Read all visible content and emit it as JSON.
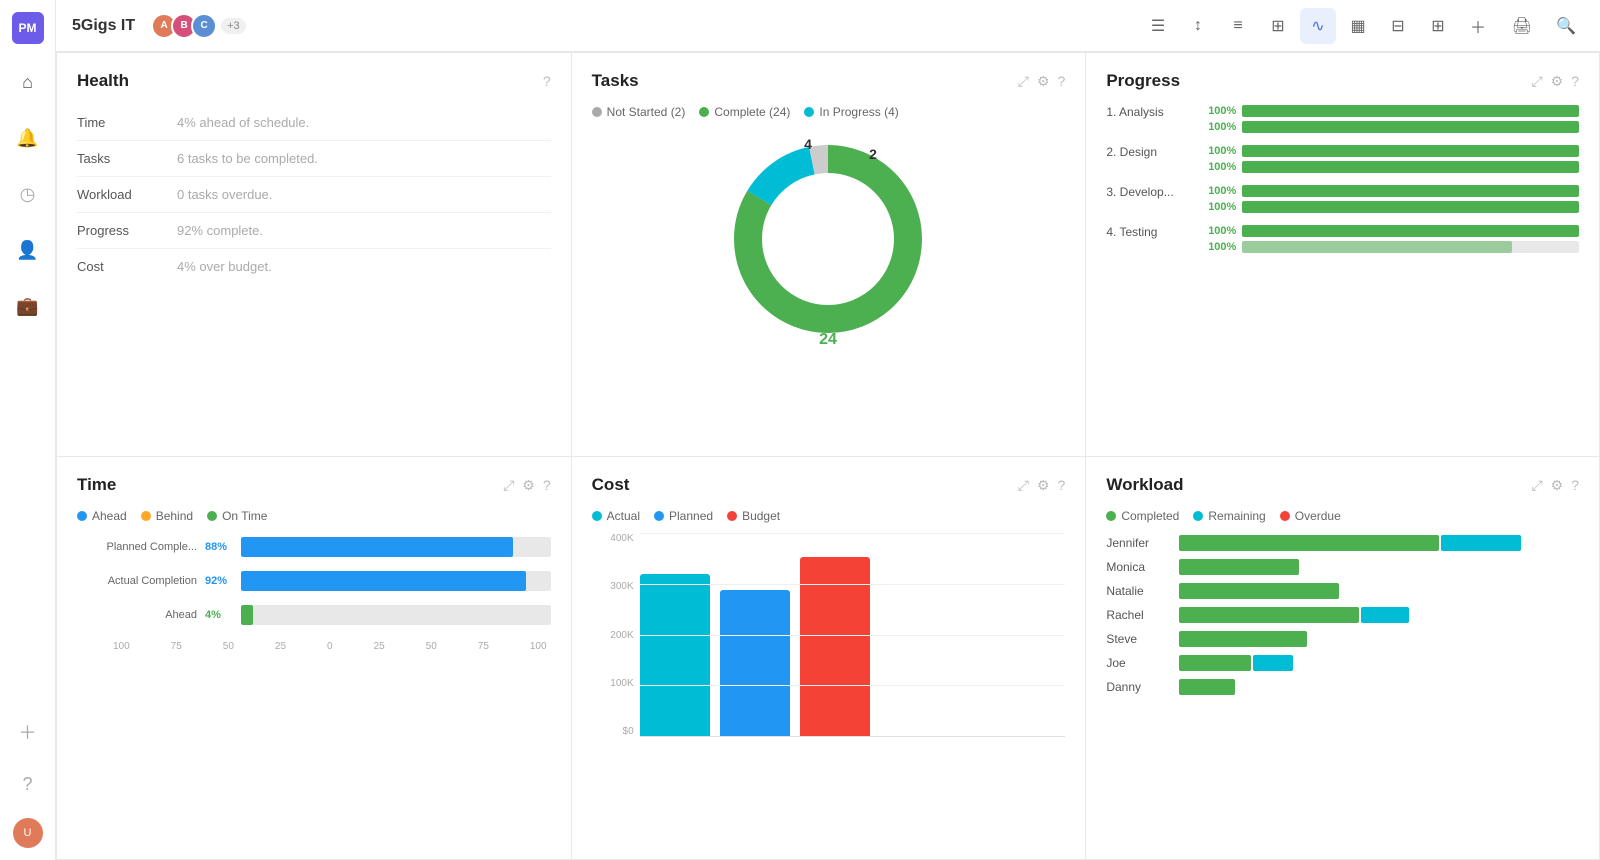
{
  "app": {
    "logo_text": "PM",
    "project_title": "5Gigs IT",
    "member_count": "+3"
  },
  "nav": {
    "icons": [
      "☰",
      "↕",
      "≡",
      "⊞",
      "∿",
      "▦",
      "⊟",
      "+"
    ],
    "right_icons": [
      "🖨",
      "🔍"
    ]
  },
  "health": {
    "title": "Health",
    "rows": [
      {
        "label": "Time",
        "value": "4% ahead of schedule."
      },
      {
        "label": "Tasks",
        "value": "6 tasks to be completed."
      },
      {
        "label": "Workload",
        "value": "0 tasks overdue."
      },
      {
        "label": "Progress",
        "value": "92% complete."
      },
      {
        "label": "Cost",
        "value": "4% over budget."
      }
    ]
  },
  "tasks": {
    "title": "Tasks",
    "legend": [
      {
        "label": "Not Started (2)",
        "color": "#aaa"
      },
      {
        "label": "Complete (24)",
        "color": "#4caf50"
      },
      {
        "label": "In Progress (4)",
        "color": "#00bcd4"
      }
    ],
    "not_started": 2,
    "complete": 24,
    "in_progress": 4,
    "labels": {
      "top_left": "4",
      "top_right": "2",
      "bottom": "24"
    }
  },
  "progress": {
    "title": "Progress",
    "sections": [
      {
        "name": "1. Analysis",
        "bars": [
          {
            "pct": "100%",
            "value": 100
          },
          {
            "pct": "100%",
            "value": 100
          }
        ]
      },
      {
        "name": "2. Design",
        "bars": [
          {
            "pct": "100%",
            "value": 100
          },
          {
            "pct": "100%",
            "value": 100
          }
        ]
      },
      {
        "name": "3. Develop...",
        "bars": [
          {
            "pct": "100%",
            "value": 100
          },
          {
            "pct": "100%",
            "value": 100
          }
        ]
      },
      {
        "name": "4. Testing",
        "bars": [
          {
            "pct": "100%",
            "value": 100
          },
          {
            "pct": "100%",
            "value": 80
          }
        ]
      }
    ]
  },
  "time": {
    "title": "Time",
    "legend": [
      {
        "label": "Ahead",
        "color": "#2196f3"
      },
      {
        "label": "Behind",
        "color": "#ffa726"
      },
      {
        "label": "On Time",
        "color": "#4caf50"
      }
    ],
    "bars": [
      {
        "label": "Planned Comple...",
        "pct": "88%",
        "value": 88,
        "color": "#2196f3"
      },
      {
        "label": "Actual Completion",
        "pct": "92%",
        "value": 92,
        "color": "#2196f3"
      },
      {
        "label": "Ahead",
        "pct": "4%",
        "value": 4,
        "color": "#4caf50"
      }
    ],
    "x_axis": [
      "100",
      "75",
      "50",
      "25",
      "0",
      "25",
      "50",
      "75",
      "100"
    ]
  },
  "cost": {
    "title": "Cost",
    "legend": [
      {
        "label": "Actual",
        "color": "#00bcd4"
      },
      {
        "label": "Planned",
        "color": "#2196f3"
      },
      {
        "label": "Budget",
        "color": "#f44336"
      }
    ],
    "y_axis": [
      "400K",
      "300K",
      "200K",
      "100K",
      "$0"
    ],
    "bars": [
      {
        "label": "Actual",
        "color": "#00bcd4",
        "height_pct": 80
      },
      {
        "label": "Planned",
        "color": "#2196f3",
        "height_pct": 72
      },
      {
        "label": "Budget",
        "color": "#f44336",
        "height_pct": 88
      }
    ]
  },
  "workload": {
    "title": "Workload",
    "legend": [
      {
        "label": "Completed",
        "color": "#4caf50"
      },
      {
        "label": "Remaining",
        "color": "#00bcd4"
      },
      {
        "label": "Overdue",
        "color": "#f44336"
      }
    ],
    "rows": [
      {
        "name": "Jennifer",
        "completed": 65,
        "remaining": 20,
        "overdue": 0
      },
      {
        "name": "Monica",
        "completed": 30,
        "remaining": 0,
        "overdue": 0
      },
      {
        "name": "Natalie",
        "completed": 40,
        "remaining": 0,
        "overdue": 0
      },
      {
        "name": "Rachel",
        "completed": 45,
        "remaining": 12,
        "overdue": 0
      },
      {
        "name": "Steve",
        "completed": 32,
        "remaining": 0,
        "overdue": 0
      },
      {
        "name": "Joe",
        "completed": 18,
        "remaining": 10,
        "overdue": 0
      },
      {
        "name": "Danny",
        "completed": 14,
        "remaining": 0,
        "overdue": 0
      }
    ]
  },
  "avatars": [
    {
      "color": "#e07b5a",
      "initials": "A"
    },
    {
      "color": "#d44f7a",
      "initials": "B"
    },
    {
      "color": "#5a8fd4",
      "initials": "C"
    }
  ]
}
